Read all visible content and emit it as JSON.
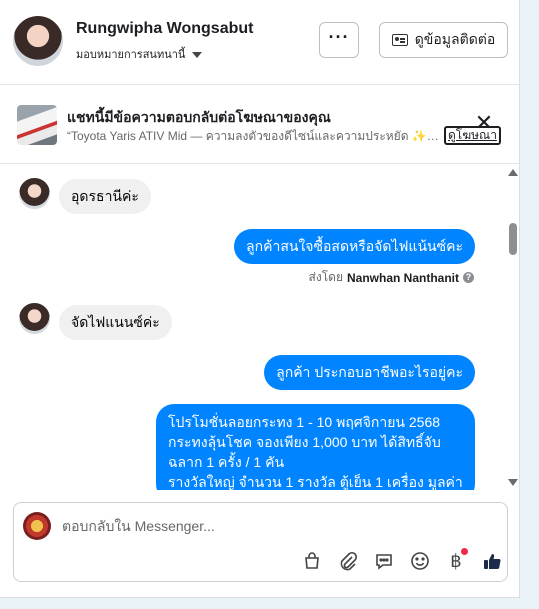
{
  "header": {
    "contact_name": "Rungwipha Wongsabut",
    "assign_label": "มอบหมายการสนทนานี้",
    "more_label": "···",
    "contact_info_label": "ดูข้อมูลติดต่อ"
  },
  "ad_banner": {
    "title": "แชทนี้มีข้อความตอบกลับต่อโฆษณาของคุณ",
    "description": "“Toyota Yaris ATIV Mid — ความลงตัวของดีไซน์และความประหยัด ✨” ...",
    "close_label": "✕",
    "view_ad_label": "ดูโฆษณา"
  },
  "messages": [
    {
      "direction": "in",
      "text": "อุดรธานีค่ะ"
    },
    {
      "direction": "out",
      "text": "ลูกค้าสนใจซื้อสดหรือจัดไฟแน้นซ์คะ"
    },
    {
      "direction": "in",
      "text": "จัดไฟแนนซ์ค่ะ"
    },
    {
      "direction": "out",
      "text": "ลูกค้า ประกอบอาชีพอะไรอยู่คะ"
    },
    {
      "direction": "out",
      "text": "โปรโมชั่นลอยกระทง 1 - 10 พฤศจิกายน 2568\nกระทงลุ้นโชค จองเพียง 1,000 บาท ได้สิทธิ์จับ\nฉลาก 1 ครั้ง /  1 คัน\nรางวัลใหญ่  จำนวน 1 รางวัล   ตู้เย็น 1  เครื่อง  มูลค่า"
    }
  ],
  "sent_by": {
    "prefix": "ส่งโดย",
    "name": "Nanwhan Nanthanit",
    "help_icon": "?"
  },
  "composer": {
    "placeholder": "ตอบกลับใน Messenger...",
    "tools": [
      "shopping-bag-icon",
      "paperclip-icon",
      "saved-reply-icon",
      "emoji-icon",
      "baht-icon",
      "thumbs-up-icon"
    ],
    "baht_symbol": "฿"
  },
  "colors": {
    "outgoing_bubble": "#0084ff",
    "incoming_bubble": "#f0f0f0",
    "notification_dot": "#f02849"
  }
}
